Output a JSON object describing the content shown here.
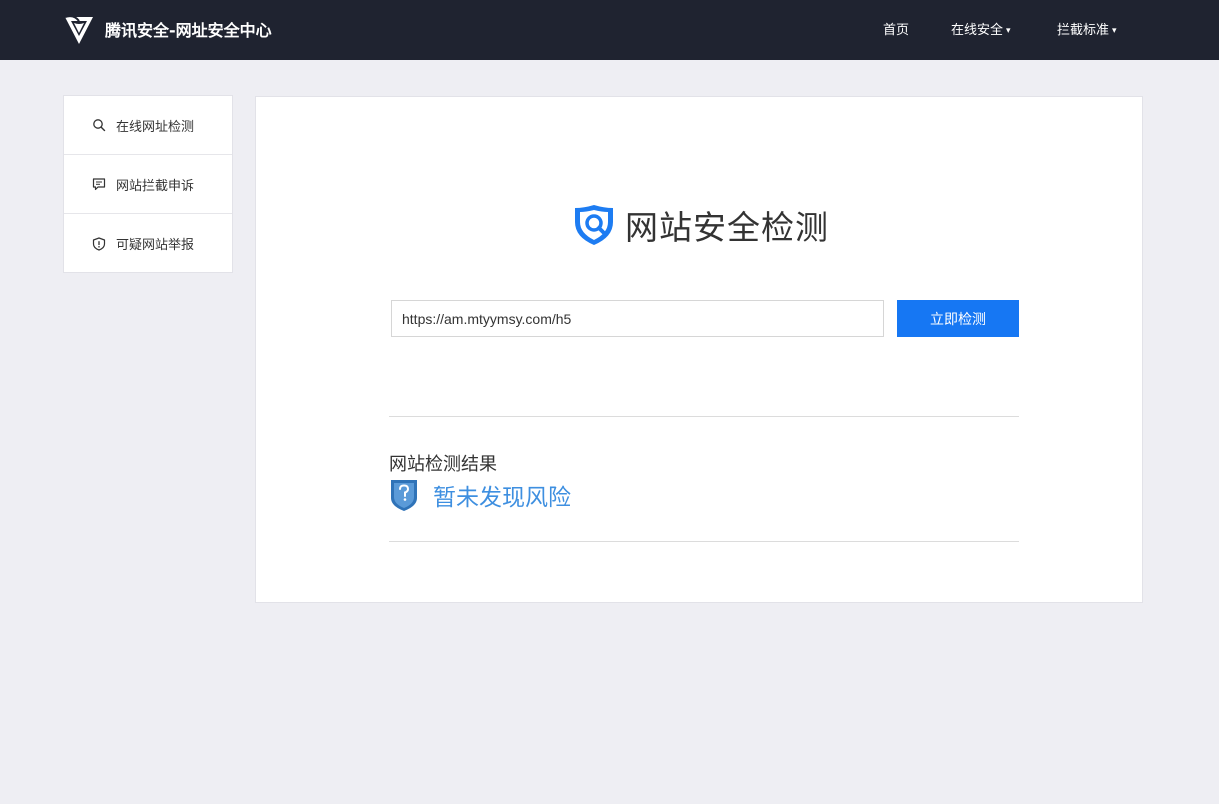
{
  "header": {
    "brand_title": "腾讯安全-网址安全中心",
    "nav": [
      {
        "label": "首页",
        "has_dropdown": false
      },
      {
        "label": "在线安全",
        "has_dropdown": true
      },
      {
        "label": "拦截标准",
        "has_dropdown": true
      }
    ],
    "dropdown_caret": "▾"
  },
  "sidebar": {
    "items": [
      {
        "label": "在线网址检测",
        "icon": "search-icon"
      },
      {
        "label": "网站拦截申诉",
        "icon": "message-icon"
      },
      {
        "label": "可疑网站举报",
        "icon": "shield-alert-icon"
      }
    ]
  },
  "main": {
    "title": "网站安全检测",
    "url_input_value": "https://am.mtyymsy.com/h5",
    "check_button_label": "立即检测",
    "result_label": "网站检测结果",
    "result_status": "暂未发现风险"
  },
  "colors": {
    "header_bg": "#1f2330",
    "page_bg": "#eeeef3",
    "accent": "#1677f3",
    "result_text": "#3e8fe0"
  }
}
